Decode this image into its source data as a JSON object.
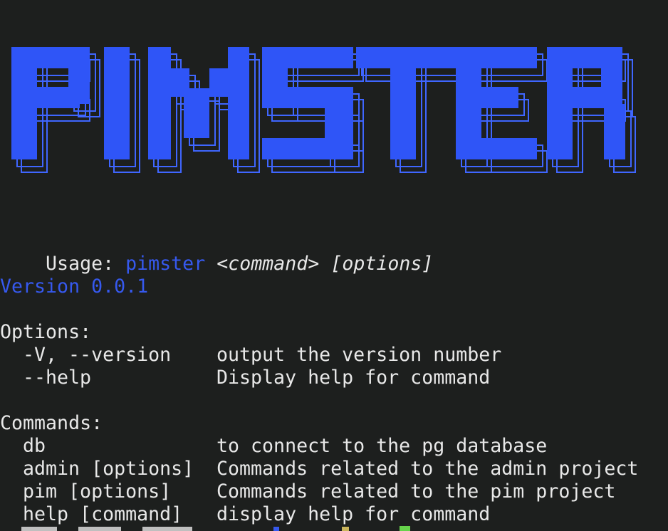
{
  "banner": {
    "text": "PIMSTER",
    "fill_color": "#2f55f7",
    "outline_color": "#3f66ff"
  },
  "usage": {
    "label": "Usage: ",
    "program": "pimster",
    "space": " ",
    "command": "<command>",
    "options": " [options]"
  },
  "version_line": "Version 0.0.1",
  "options": {
    "heading": "Options:",
    "items": [
      {
        "flag": "-V, --version",
        "description": "output the version number"
      },
      {
        "flag": "--help",
        "description": "Display help for command"
      }
    ]
  },
  "commands": {
    "heading": "Commands:",
    "items": [
      {
        "name": "db",
        "description": "to connect to the pg database"
      },
      {
        "name": "admin [options]",
        "description": "Commands related to the admin project"
      },
      {
        "name": "pim [options]",
        "description": "Commands related to the pim project"
      },
      {
        "name": "help [command]",
        "description": "display help for command"
      }
    ]
  },
  "colors": {
    "background": "#1d1f1e",
    "text": "#e8e8e8",
    "accent": "#3659ee",
    "cursor": "#66d34b"
  }
}
